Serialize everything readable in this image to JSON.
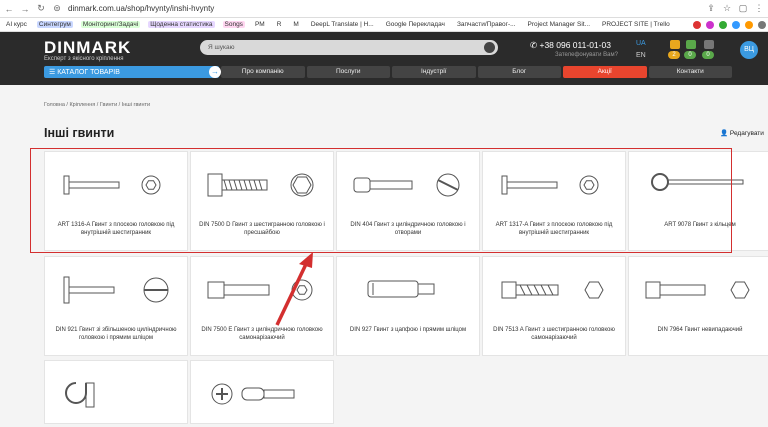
{
  "browser": {
    "url": "dinmark.com.ua/shop/hvynty/inshi-hvynty",
    "bookmarks": [
      {
        "label": "AI курс",
        "tag": ""
      },
      {
        "label": "Синтегрум",
        "tag": "#c9d7ff"
      },
      {
        "label": "Моніторинг/Задачі",
        "tag": "#d9ffd6"
      },
      {
        "label": "Щоденна статистика",
        "tag": "#e6d7ff"
      },
      {
        "label": "Songs",
        "tag": "#ffd6f0"
      },
      {
        "label": "PM",
        "tag": ""
      },
      {
        "label": "R",
        "tag": ""
      },
      {
        "label": "M",
        "tag": ""
      },
      {
        "label": "DeepL Translate | H...",
        "tag": ""
      },
      {
        "label": "Google Перекладач",
        "tag": ""
      },
      {
        "label": "Запчасти/Правог-...",
        "tag": ""
      },
      {
        "label": "Project Manager Sit...",
        "tag": ""
      },
      {
        "label": "PROJECT SITE | Trello",
        "tag": ""
      }
    ]
  },
  "header": {
    "logo": "DINMARK",
    "logo_sub": "Експерт з якісного кріплення",
    "search_placeholder": "Я шукаю",
    "phone": "+38 096 011-01-03",
    "callback": "Зателефонувати Вам?",
    "lang_ua": "UA",
    "lang_en": "EN",
    "badge_fav": "2",
    "badge_cmp": "0",
    "badge_cart": "0",
    "avatar": "ВЦ",
    "catalog": "КАТАЛОГ ТОВАРІВ",
    "nav": [
      "Про компанію",
      "Послуги",
      "Індустрії",
      "Блог",
      "Акції",
      "Контакти"
    ]
  },
  "breadcrumb": "Головна / Кріплення / Гвинти / Інші гвинти",
  "page_title": "Інші гвинти",
  "edit_label": "Редагувати",
  "products": [
    {
      "title": "ART 1316-A Гвинт з плоскою головкою під внутрішній шестигранник",
      "icon": "flat-head-hex-socket-screw-icon"
    },
    {
      "title": "DIN 7500 D Гвинт з шестигранною головкою і пресшайбою",
      "icon": "hex-flange-screw-icon"
    },
    {
      "title": "DIN 404 Гвинт з циліндричною головкою і отворами",
      "icon": "slotted-capstan-screw-icon"
    },
    {
      "title": "ART 1317-A Гвинт з плоскою головкою під внутрішній шестигранник",
      "icon": "flat-head-hex-socket-screw-icon"
    },
    {
      "title": "ART 9078 Гвинт з кільцем",
      "icon": "ring-screw-icon"
    },
    {
      "title": "DIN 921 Гвинт зі збільшеною циліндричною головкою і прямим шліцом",
      "icon": "large-cheese-head-screw-icon"
    },
    {
      "title": "DIN 7500 E Гвинт з циліндричною головкою самонарізаючий",
      "icon": "socket-thread-forming-screw-icon"
    },
    {
      "title": "DIN 927 Гвинт з цапфою і прямим шліцом",
      "icon": "shoulder-slotted-screw-icon"
    },
    {
      "title": "DIN 7513 A Гвинт з шестигранною головкою самонарізаючий",
      "icon": "hex-thread-cutting-screw-icon"
    },
    {
      "title": "DIN 7964 Гвинт невипадаючий",
      "icon": "captive-screw-icon"
    },
    {
      "title": "",
      "icon": "hook-screw-icon"
    },
    {
      "title": "",
      "icon": "phillips-screw-icon"
    }
  ],
  "colors": {
    "accent": "#3b9ae1",
    "promo": "#e8452e",
    "highlight": "#d32f2f"
  }
}
